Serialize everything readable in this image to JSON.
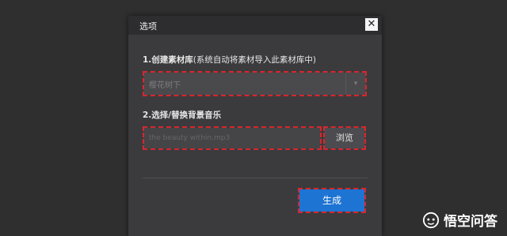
{
  "dialog": {
    "title": "选项",
    "close_label": "✕"
  },
  "library": {
    "label": "1.创建素材库",
    "hint": "(系统自动将素材导入此素材库中)",
    "selected_value": "樱花树下",
    "arrow": "▾"
  },
  "music": {
    "label": "2.选择/替换背景音乐",
    "placeholder": "the beauty within.mp3",
    "browse_label": "浏览"
  },
  "actions": {
    "generate_label": "生成"
  },
  "watermark": {
    "text": "悟空问答"
  },
  "colors": {
    "accent": "#1e74d3",
    "highlight": "#d8262e"
  }
}
